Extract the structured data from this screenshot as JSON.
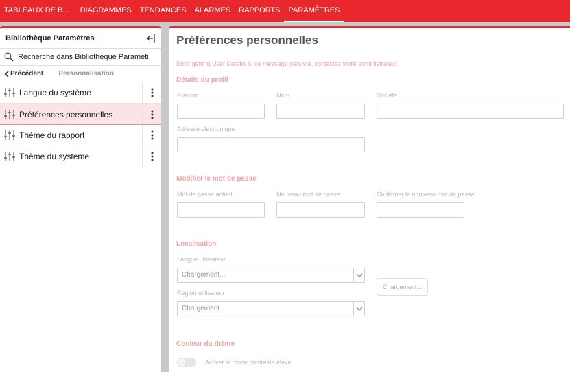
{
  "nav": {
    "items": [
      {
        "label": "TABLEAUX DE B..."
      },
      {
        "label": "DIAGRAMMES"
      },
      {
        "label": "TENDANCES"
      },
      {
        "label": "ALARMES"
      },
      {
        "label": "RAPPORTS"
      },
      {
        "label": "PARAMÈTRES",
        "active": true
      }
    ]
  },
  "sidebar": {
    "title": "Bibliothèque Paramètres",
    "search_value": "Recherche dans Bibliothèque Paramètr",
    "back_label": "Précédent",
    "breadcrumb": "Personnalisation",
    "items": [
      {
        "label": "Langue du système"
      },
      {
        "label": "Préférences personnelles",
        "selected": true
      },
      {
        "label": "Thème du rapport"
      },
      {
        "label": "Thème du système"
      }
    ]
  },
  "main": {
    "title": "Préférences personnelles",
    "error": "Error getting User Details Si ce message persiste, contactez votre administrateur.",
    "profile": {
      "title": "Détails du profil",
      "first_name_label": "Prénom",
      "last_name_label": "Nom",
      "company_label": "Société",
      "email_label": "Adresse électronique"
    },
    "password": {
      "title": "Modifier le mot de passe",
      "current_label": "Mot de passe actuel",
      "new_label": "Nouveau mot de passe",
      "confirm_label": "Confirmer le nouveau mot de passe"
    },
    "localisation": {
      "title": "Localisation",
      "language_label": "Langue utilisateur",
      "language_value": "Chargement...",
      "region_label": "Région utilisateur",
      "region_value": "Chargement...",
      "loading_button": "Chargement..."
    },
    "theme": {
      "title": "Couleur du thème",
      "contrast_label": "Activer le mode contraste élevé",
      "contrast_enabled": false
    }
  },
  "colors": {
    "brand_red": "#e8282d",
    "accent_border": "#d23237",
    "section_pink": "#f0a4a6"
  }
}
